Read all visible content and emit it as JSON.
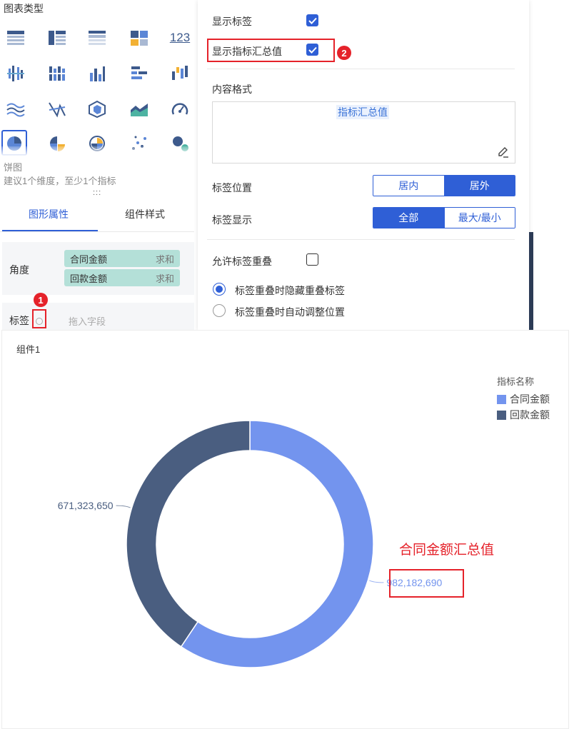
{
  "left_panel": {
    "section_title": "图表类型",
    "chart_types": [
      "table-icon",
      "cross-table-icon",
      "detail-table-icon",
      "matrix-icon",
      "kpi-number-icon",
      "grouped-bar-icon",
      "stacked-bar-icon",
      "column-icon",
      "horizontal-bar-icon",
      "waterfall-icon",
      "area-wave-icon",
      "radar-line-icon",
      "radar-icon",
      "area-chart-icon",
      "gauge-icon",
      "pie-icon",
      "half-pie-icon",
      "rose-icon",
      "scatter-icon",
      "bubble-icon"
    ],
    "kpi_icon_text": "123",
    "selected_chart_name": "饼图",
    "selected_chart_hint": "建议1个维度，至少1个指标",
    "drag_handle": ":::",
    "tabs": [
      {
        "label": "图形属性",
        "active": true
      },
      {
        "label": "组件样式",
        "active": false
      }
    ],
    "angle": {
      "label": "角度",
      "fields": [
        {
          "name": "合同金额",
          "agg": "求和"
        },
        {
          "name": "回款金额",
          "agg": "求和"
        }
      ]
    },
    "label_row": {
      "label": "标签",
      "placeholder": "拖入字段",
      "badge": "1"
    }
  },
  "popup": {
    "show_label": {
      "label": "显示标签",
      "checked": true
    },
    "show_total": {
      "label": "显示指标汇总值",
      "checked": true,
      "badge": "2"
    },
    "content_format": {
      "label": "内容格式",
      "token": "指标汇总值"
    },
    "label_position": {
      "label": "标签位置",
      "options": [
        "居内",
        "居外"
      ],
      "selected": "居外"
    },
    "label_display": {
      "label": "标签显示",
      "options": [
        "全部",
        "最大/最小"
      ],
      "selected": "全部"
    },
    "allow_overlap": {
      "label": "允许标签重叠",
      "checked": false
    },
    "overlap_options": [
      {
        "label": "标签重叠时隐藏重叠标签",
        "selected": true
      },
      {
        "label": "标签重叠时自动调整位置",
        "selected": false
      }
    ]
  },
  "widget": {
    "title": "组件1",
    "annotation": "合同金额汇总值"
  },
  "chart_data": {
    "type": "pie",
    "variant": "donut",
    "legend_title": "指标名称",
    "legend_position": "top-right",
    "series": [
      {
        "name": "合同金额",
        "value": 982182690,
        "label": "982,182,690",
        "color": "#7394ee"
      },
      {
        "name": "回款金额",
        "value": 671323650,
        "label": "671,323,650",
        "color": "#4a5e80"
      }
    ]
  },
  "colors": {
    "accent": "#2f5fd6",
    "highlight": "#e5222a",
    "field_pill": "#b4e0d8"
  }
}
